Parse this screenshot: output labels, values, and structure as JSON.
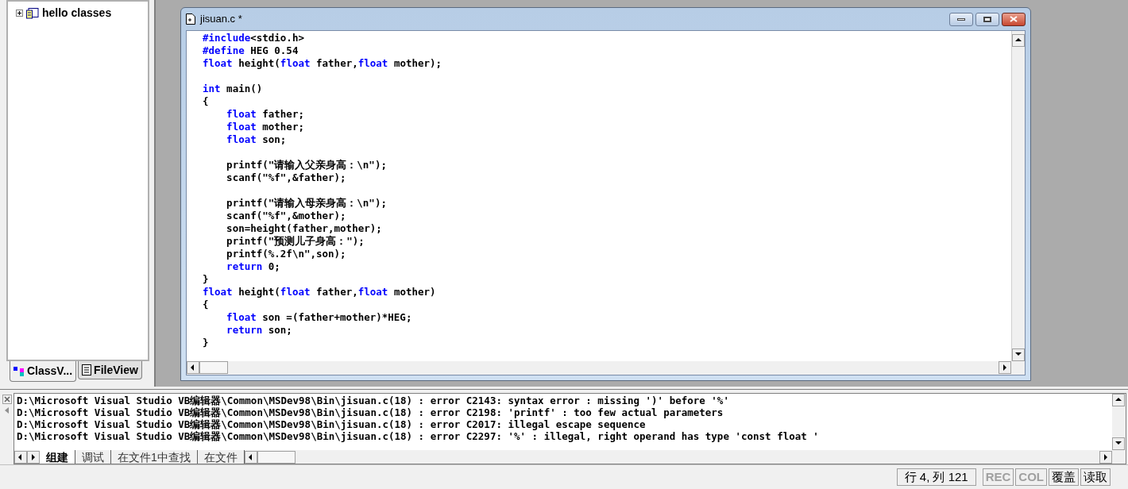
{
  "workspace": {
    "tree": [
      {
        "label": "hello classes",
        "expanded": false
      }
    ],
    "tabs": [
      {
        "label": "ClassV...",
        "selected": true
      },
      {
        "label": "FileView",
        "selected": false
      }
    ]
  },
  "editor": {
    "title": "jisuan.c *",
    "blocks": [
      [
        [
          {
            "kind": "keyword",
            "text": "#include"
          },
          {
            "kind": "plain",
            "text": "<stdio.h>"
          }
        ],
        [
          {
            "kind": "keyword",
            "text": "#define"
          },
          {
            "kind": "plain",
            "text": " HEG 0.54"
          }
        ],
        [
          {
            "kind": "keyword",
            "text": "float"
          },
          {
            "kind": "plain",
            "text": " height("
          },
          {
            "kind": "keyword",
            "text": "float"
          },
          {
            "kind": "plain",
            "text": " father,"
          },
          {
            "kind": "keyword",
            "text": "float"
          },
          {
            "kind": "plain",
            "text": " mother);"
          }
        ]
      ],
      [
        [
          {
            "kind": "keyword",
            "text": "int"
          },
          {
            "kind": "plain",
            "text": " main()"
          }
        ],
        [
          {
            "kind": "plain",
            "text": "{"
          }
        ],
        [
          {
            "kind": "keyword",
            "text": "    float"
          },
          {
            "kind": "plain",
            "text": " father;"
          }
        ],
        [
          {
            "kind": "keyword",
            "text": "    float"
          },
          {
            "kind": "plain",
            "text": " mother;"
          }
        ],
        [
          {
            "kind": "keyword",
            "text": "    float"
          },
          {
            "kind": "plain",
            "text": " son;"
          }
        ]
      ],
      [
        [
          {
            "kind": "plain",
            "text": "    printf(\"请输入父亲身高：\\n\");"
          }
        ],
        [
          {
            "kind": "plain",
            "text": "    scanf(\"%f\",&father);"
          }
        ]
      ],
      [
        [
          {
            "kind": "plain",
            "text": "    printf(\"请输入母亲身高：\\n\");"
          }
        ],
        [
          {
            "kind": "plain",
            "text": "    scanf(\"%f\",&mother);"
          }
        ],
        [
          {
            "kind": "plain",
            "text": "    son=height(father,mother);"
          }
        ],
        [
          {
            "kind": "plain",
            "text": "    printf(\"预测儿子身高：\");"
          }
        ],
        [
          {
            "kind": "plain",
            "text": "    printf(%.2f\\n\",son);"
          }
        ],
        [
          {
            "kind": "keyword",
            "text": "    return"
          },
          {
            "kind": "plain",
            "text": " 0;"
          }
        ],
        [
          {
            "kind": "plain",
            "text": "}"
          }
        ],
        [
          {
            "kind": "keyword",
            "text": "float"
          },
          {
            "kind": "plain",
            "text": " height("
          },
          {
            "kind": "keyword",
            "text": "float"
          },
          {
            "kind": "plain",
            "text": " father,"
          },
          {
            "kind": "keyword",
            "text": "float"
          },
          {
            "kind": "plain",
            "text": " mother)"
          }
        ],
        [
          {
            "kind": "plain",
            "text": "{"
          }
        ],
        [
          {
            "kind": "keyword",
            "text": "    float"
          },
          {
            "kind": "plain",
            "text": " son =(father+mother)*HEG;"
          }
        ],
        [
          {
            "kind": "keyword",
            "text": "    return"
          },
          {
            "kind": "plain",
            "text": " son;"
          }
        ],
        [
          {
            "kind": "plain",
            "text": "}"
          }
        ]
      ]
    ]
  },
  "output": {
    "lines": [
      "D:\\Microsoft Visual Studio VB编辑器\\Common\\MSDev98\\Bin\\jisuan.c(18) : error C2143: syntax error : missing ')' before '%'",
      "D:\\Microsoft Visual Studio VB编辑器\\Common\\MSDev98\\Bin\\jisuan.c(18) : error C2198: 'printf' : too few actual parameters",
      "D:\\Microsoft Visual Studio VB编辑器\\Common\\MSDev98\\Bin\\jisuan.c(18) : error C2017: illegal escape sequence",
      "D:\\Microsoft Visual Studio VB编辑器\\Common\\MSDev98\\Bin\\jisuan.c(18) : error C2297: '%' : illegal, right operand has type 'const float '"
    ],
    "tabs": [
      {
        "label": "组建",
        "selected": true
      },
      {
        "label": "调试",
        "selected": false
      },
      {
        "label": "在文件1中查找",
        "selected": false
      },
      {
        "label": "在文件",
        "selected": false
      }
    ]
  },
  "status_bar": [
    {
      "text": "行 4, 列 121",
      "disabled": false
    },
    {
      "text": "REC",
      "disabled": true
    },
    {
      "text": "COL",
      "disabled": true
    },
    {
      "text": "覆盖",
      "disabled": false
    },
    {
      "text": "读取",
      "disabled": false
    }
  ]
}
